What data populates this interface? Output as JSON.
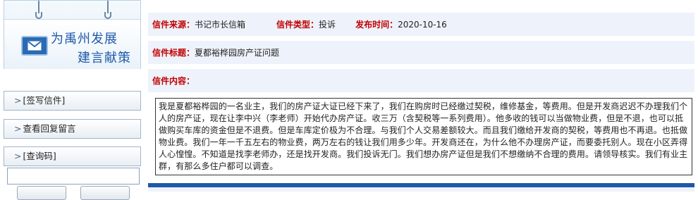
{
  "sidebar": {
    "banner": {
      "title_line1": "为禹州发展",
      "title_line2": "建言献策"
    },
    "nav": [
      {
        "arrow": ">",
        "label": "[签写信件]"
      },
      {
        "arrow": ">",
        "label": "查看回复留言"
      },
      {
        "arrow": ">",
        "label": "[查询码]"
      }
    ],
    "query_input": {
      "value": ""
    }
  },
  "letter": {
    "source_label": "信件来源：",
    "source_value": "书记市长信箱",
    "type_label": "信件类型：",
    "type_value": "投诉",
    "time_label": "发布时间：",
    "time_value": "2020-10-16",
    "title_label": "信件标题：",
    "title_value": "夏都裕桦园房产证问题",
    "content_label": "信件内容：",
    "content_text": "我是夏都裕桦园的一名业主，我们的房产证大证已经下来了，我们在购房时已经缴过契税，维修基金，等费用。但是开发商迟迟不办理我们个人的房产证，现在让李中兴（李老师）开始代办房产证。收三万（含契税等一系列费用）。他多收的钱可以当做物业费，但是不退，也可以抵做购买车库的资金但是不退费。但是车库定价极为不合理。与我们个人交易差额较大。而且我们缴给开发商的契税，等费用也不再退。也抵做物业费。我们一年一千五左右的物业费，两万左右的钱让我们用多少年。开发商还在，为什么他不办理房产证，而要委托别人。现在小区弄得人心惶惶。不知道是找李老师办，还是找开发商。我们投诉无门。我们想办房产证但是我们不想缴纳不合理的费用。请领导核实。我们有业主群，有那么多住户都可以调查。"
  },
  "colors": {
    "label_red": "#c00000",
    "row_bg": "#eef2fb",
    "accent_blue": "#1f58a8"
  },
  "icons": {
    "banner_icon": "envelope-icon",
    "nav_arrow": "chevron-right"
  }
}
